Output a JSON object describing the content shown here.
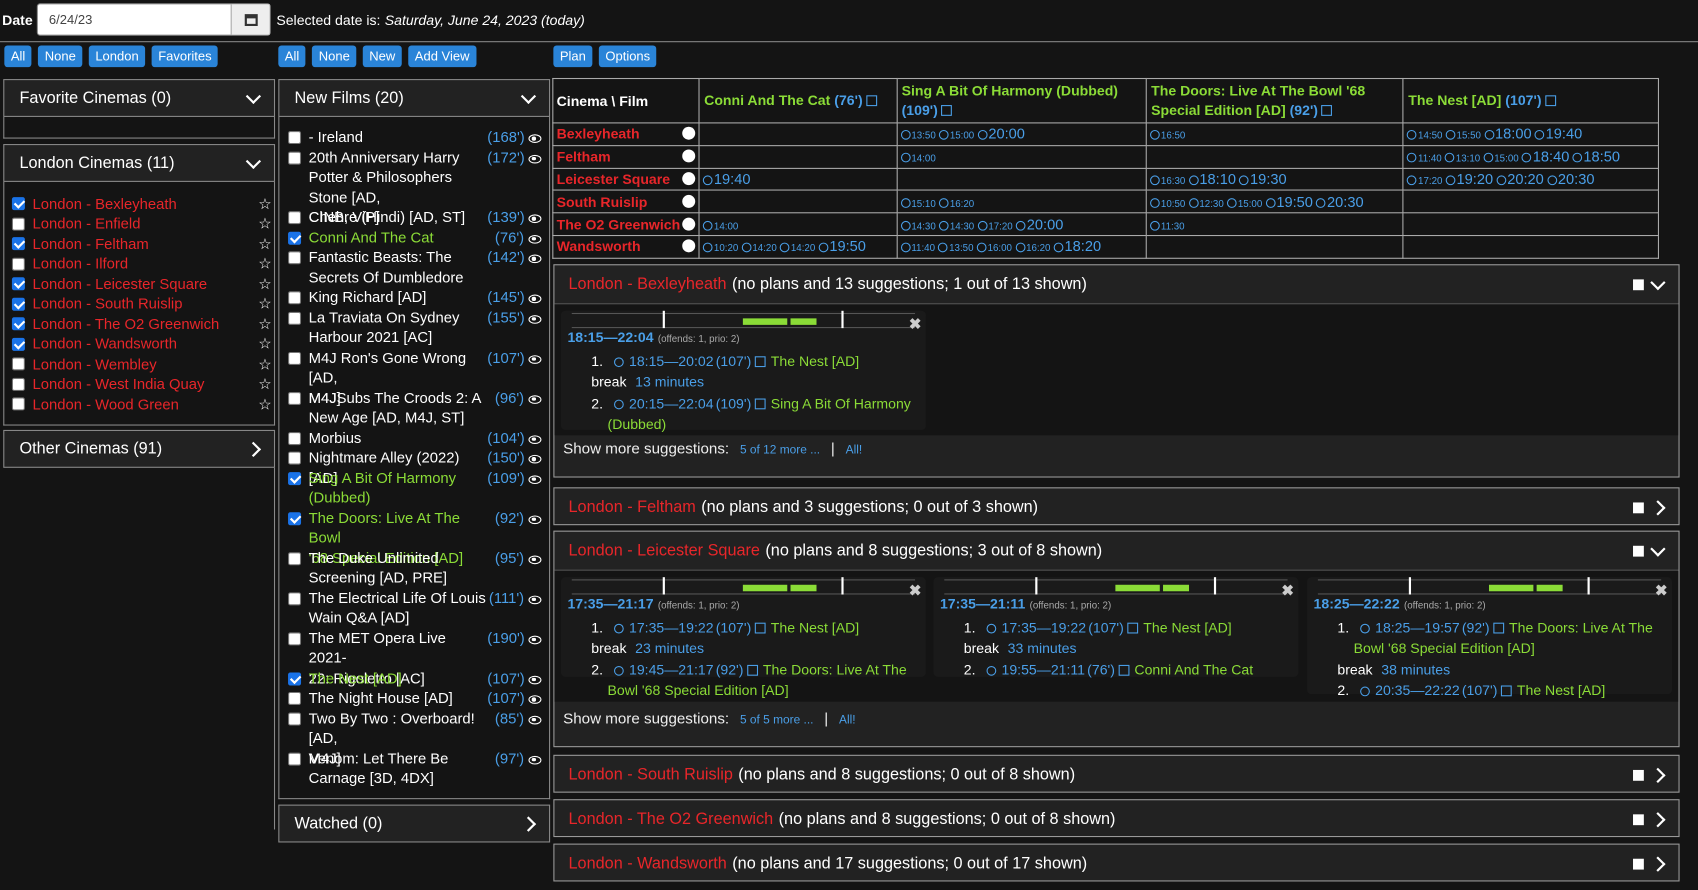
{
  "date": {
    "label": "Date",
    "value": "6/24/23",
    "selected_prefix": "Selected date is:",
    "selected_text": "Saturday, June 24, 2023 (today)"
  },
  "cinema_filters": [
    "All",
    "None",
    "London",
    "Favorites"
  ],
  "film_filters": [
    "All",
    "None",
    "New",
    "Add View"
  ],
  "plan_buttons": [
    "Plan",
    "Options"
  ],
  "favorites_header": "Favorite Cinemas (0)",
  "london_header": "London Cinemas (11)",
  "other_header": "Other Cinemas (91)",
  "london_cinemas": [
    {
      "name": "London - Bexleyheath",
      "checked": true
    },
    {
      "name": "London - Enfield",
      "checked": false
    },
    {
      "name": "London - Feltham",
      "checked": true
    },
    {
      "name": "London - Ilford",
      "checked": false
    },
    {
      "name": "London - Leicester Square",
      "checked": true
    },
    {
      "name": "London - South Ruislip",
      "checked": true
    },
    {
      "name": "London - The O2 Greenwich",
      "checked": true
    },
    {
      "name": "London - Wandsworth",
      "checked": true
    },
    {
      "name": "London - Wembley",
      "checked": false
    },
    {
      "name": "London - West India Quay",
      "checked": false
    },
    {
      "name": "London - Wood Green",
      "checked": false
    }
  ],
  "new_films_header": "New Films (20)",
  "watched_header": "Watched (0)",
  "films": [
    {
      "l1": "- Ireland",
      "l2": "",
      "dur": "(168')",
      "checked": false
    },
    {
      "l1": "20th Anniversary Harry",
      "l2": "Potter & Philosophers Stone [AD,",
      "l3": "CINB, ViP]",
      "dur": "(172')",
      "checked": false
    },
    {
      "l1": "Chehre (Hindi) [AD, ST]",
      "l2": "",
      "dur": "(139')",
      "checked": false
    },
    {
      "l1": "Conni And The Cat",
      "l2": "",
      "dur": "(76')",
      "checked": true
    },
    {
      "l1": "Fantastic Beasts: The",
      "l2": "Secrets Of Dumbledore",
      "dur": "(142')",
      "checked": false
    },
    {
      "l1": "King Richard [AD]",
      "l2": "",
      "dur": "(145')",
      "checked": false
    },
    {
      "l1": "La Traviata On Sydney",
      "l2": "Harbour 2021 [AC]",
      "dur": "(155')",
      "checked": false
    },
    {
      "l1": "M4J Ron's Gone Wrong [AD,",
      "l2": "M4J]",
      "dur": "(107')",
      "checked": false
    },
    {
      "l1": "M4JSubs The Croods 2: A",
      "l2": "New Age [AD, M4J, ST]",
      "dur": "(96')",
      "checked": false
    },
    {
      "l1": "Morbius",
      "l2": "",
      "dur": "(104')",
      "checked": false
    },
    {
      "l1": "Nightmare Alley (2022) [AD]",
      "l2": "",
      "dur": "(150')",
      "checked": false
    },
    {
      "l1": "Sing A Bit Of Harmony",
      "l2": "(Dubbed)",
      "dur": "(109')",
      "checked": true
    },
    {
      "l1": "The Doors: Live At The Bowl",
      "l2": "'68 Special Edition [AD]",
      "dur": "(92')",
      "checked": true
    },
    {
      "l1": "The Duke Unlimited",
      "l2": "Screening [AD, PRE]",
      "dur": "(95')",
      "checked": false
    },
    {
      "l1": "The Electrical Life Of Louis",
      "l2": "Wain Q&A [AD]",
      "dur": "(111')",
      "checked": false
    },
    {
      "l1": "The MET Opera Live 2021-",
      "l2": "22: Rigoletto [AC]",
      "dur": "(190')",
      "checked": false
    },
    {
      "l1": "The Nest [AD]",
      "l2": "",
      "dur": "(107')",
      "checked": true
    },
    {
      "l1": "The Night House [AD]",
      "l2": "",
      "dur": "(107')",
      "checked": false
    },
    {
      "l1": "Two By Two : Overboard! [AD,",
      "l2": "M4J]",
      "dur": "(85')",
      "checked": false
    },
    {
      "l1": "Venom: Let There Be",
      "l2": "Carnage [3D, 4DX]",
      "dur": "(97')",
      "checked": false
    }
  ],
  "grid": {
    "corner": "Cinema \\ Film",
    "cols": [
      {
        "t1": "Conni And The Cat",
        "d": "(76')",
        "t2": ""
      },
      {
        "t1": "Sing A Bit Of Harmony (Dubbed)",
        "d": "(109')",
        "t2": ""
      },
      {
        "t1": "The Doors: Live At The Bowl '68",
        "t2": "Special Edition [AD]",
        "d": "(92')"
      },
      {
        "t1": "The Nest [AD]",
        "d": "(107')",
        "t2": ""
      }
    ],
    "rows": [
      {
        "c": "Bexleyheath",
        "cells": [
          [],
          [
            [
              "13:50",
              0
            ],
            [
              "15:00",
              0
            ],
            [
              "20:00",
              1
            ]
          ],
          [
            [
              "16:50",
              0
            ]
          ],
          [
            [
              "14:50",
              0
            ],
            [
              "15:50",
              0
            ],
            [
              "18:00",
              1
            ],
            [
              "19:40",
              1
            ]
          ]
        ]
      },
      {
        "c": "Feltham",
        "cells": [
          [],
          [
            [
              "14:00",
              0
            ]
          ],
          [],
          [
            [
              "11:40",
              0
            ],
            [
              "13:10",
              0
            ],
            [
              "15:00",
              0
            ],
            [
              "18:40",
              1
            ],
            [
              "18:50",
              1
            ]
          ]
        ]
      },
      {
        "c": "Leicester Square",
        "cells": [
          [
            [
              "19:40",
              1
            ]
          ],
          [],
          [
            [
              "16:30",
              0
            ],
            [
              "18:10",
              1
            ],
            [
              "19:30",
              1
            ]
          ],
          [
            [
              "17:20",
              0
            ],
            [
              "19:20",
              1
            ],
            [
              "20:20",
              1
            ],
            [
              "20:30",
              1
            ]
          ]
        ]
      },
      {
        "c": "South Ruislip",
        "cells": [
          [],
          [
            [
              "15:10",
              0
            ],
            [
              "16:20",
              0
            ]
          ],
          [
            [
              "10:50",
              0
            ],
            [
              "12:30",
              0
            ],
            [
              "15:00",
              0
            ],
            [
              "19:50",
              1
            ],
            [
              "20:30",
              1
            ]
          ],
          []
        ]
      },
      {
        "c": "The O2 Greenwich",
        "cells": [
          [
            [
              "14:00",
              0
            ]
          ],
          [
            [
              "14:30",
              0
            ],
            [
              "14:30",
              0
            ],
            [
              "17:20",
              0
            ],
            [
              "20:00",
              1
            ]
          ],
          [
            [
              "11:30",
              0
            ]
          ],
          []
        ]
      },
      {
        "c": "Wandsworth",
        "cells": [
          [
            [
              "10:20",
              0
            ],
            [
              "14:20",
              0
            ],
            [
              "14:20",
              0
            ],
            [
              "19:50",
              1
            ]
          ],
          [
            [
              "11:40",
              0
            ],
            [
              "13:50",
              0
            ],
            [
              "16:00",
              0
            ],
            [
              "16:20",
              0
            ],
            [
              "18:20",
              1
            ]
          ],
          [],
          []
        ]
      }
    ]
  },
  "sections": [
    {
      "cin": "London - Bexleyheath",
      "info": "(no plans and 13 suggestions; 1 out of 13 shown)",
      "open": true
    },
    {
      "cin": "London - Feltham",
      "info": "(no plans and 3 suggestions; 0 out of 3 shown)",
      "open": false
    },
    {
      "cin": "London - Leicester Square",
      "info": "(no plans and 8 suggestions; 3 out of 8 shown)",
      "open": true
    },
    {
      "cin": "London - South Ruislip",
      "info": "(no plans and 8 suggestions; 0 out of 8 shown)",
      "open": false
    },
    {
      "cin": "London - The O2 Greenwich",
      "info": "(no plans and 8 suggestions; 0 out of 8 shown)",
      "open": false
    },
    {
      "cin": "London - Wandsworth",
      "info": "(no plans and 17 suggestions; 0 out of 17 shown)",
      "open": false
    }
  ],
  "suggestions": {
    "bex": {
      "range": "18:15—22:04",
      "meta": "(offends: 1, prio: 2)",
      "tl": [
        "The",
        "Sing"
      ],
      "i1": {
        "n": "1.",
        "time": "18:15—20:02",
        "d": "(107')",
        "film": "The Nest [AD]"
      },
      "brk": "13 minutes",
      "break_label": "break",
      "i2": {
        "n": "2.",
        "time": "20:15—22:04",
        "d": "(109')",
        "film": "Sing A Bit Of Harmony",
        "film2": "(Dubbed)"
      }
    },
    "ls1": {
      "range": "17:35—21:17",
      "meta": "(offends: 1, prio: 2)",
      "tl": [
        "The",
        "The"
      ],
      "i1": {
        "n": "1.",
        "time": "17:35—19:22",
        "d": "(107')",
        "film": "The Nest [AD]"
      },
      "brk": "23 minutes",
      "break_label": "break",
      "i2": {
        "n": "2.",
        "time": "19:45—21:17",
        "d": "(92')",
        "film": "The Doors: Live At The",
        "film2": "Bowl '68 Special Edition [AD]"
      }
    },
    "ls2": {
      "range": "17:35—21:11",
      "meta": "(offends: 1, prio: 2)",
      "tl": [
        "The",
        "Co"
      ],
      "i1": {
        "n": "1.",
        "time": "17:35—19:22",
        "d": "(107')",
        "film": "The Nest [AD]"
      },
      "brk": "33 minutes",
      "break_label": "break",
      "i2": {
        "n": "2.",
        "time": "19:55—21:11",
        "d": "(76')",
        "film": "Conni And The Cat"
      }
    },
    "ls3": {
      "range": "18:25—22:22",
      "meta": "(offends: 1, prio: 2)",
      "tl": [
        "The",
        "The"
      ],
      "i1": {
        "n": "1.",
        "time": "18:25—19:57",
        "d": "(92')",
        "film": "The Doors: Live At The",
        "film2": "Bowl '68 Special Edition [AD]"
      },
      "brk": "38 minutes",
      "break_label": "break",
      "i2": {
        "n": "2.",
        "time": "20:35—22:22",
        "d": "(107')",
        "film": "The Nest [AD]"
      }
    }
  },
  "more": {
    "label": "Show more suggestions:",
    "bex": "5 of 12 more ...",
    "ls": "5 of 5 more ...",
    "sep": "|",
    "all": "All!"
  }
}
